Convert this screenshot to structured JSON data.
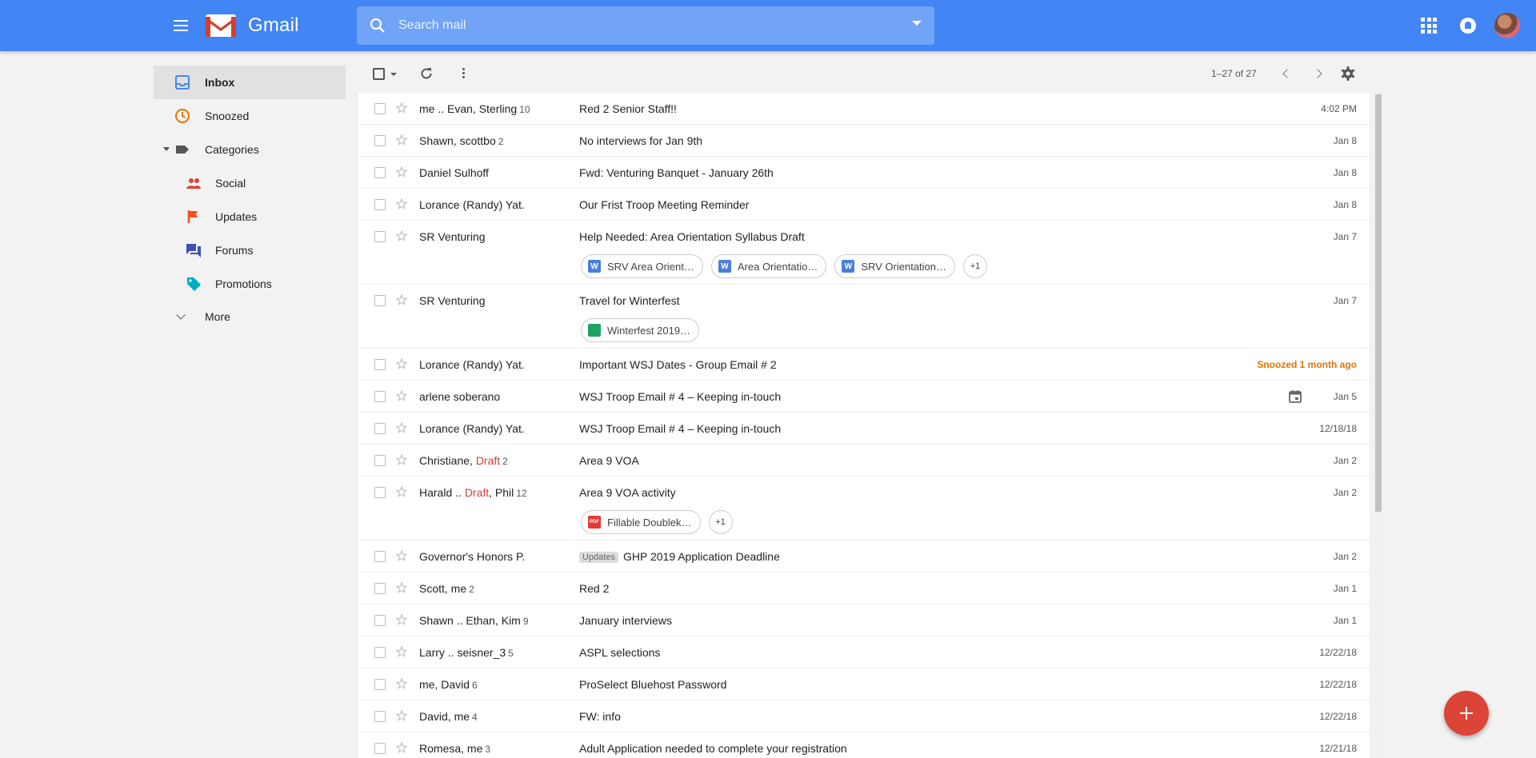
{
  "app": {
    "brand": "Gmail"
  },
  "search": {
    "placeholder": "Search mail",
    "value": ""
  },
  "sidebar": {
    "items": [
      {
        "label": "Inbox",
        "icon": "inbox-icon",
        "color": "#4285f4",
        "active": true
      },
      {
        "label": "Snoozed",
        "icon": "clock-icon",
        "color": "#e37400"
      },
      {
        "label": "Categories",
        "icon": "label-icon",
        "color": "#555555"
      },
      {
        "label": "Social",
        "icon": "people-icon",
        "color": "#db4437"
      },
      {
        "label": "Updates",
        "icon": "flag-icon",
        "color": "#f4511e"
      },
      {
        "label": "Forums",
        "icon": "forum-icon",
        "color": "#3f51b5"
      },
      {
        "label": "Promotions",
        "icon": "tag-icon",
        "color": "#00acc1"
      },
      {
        "label": "More",
        "icon": "chevron-down-icon"
      }
    ]
  },
  "toolbar": {
    "page_count": "1–27 of 27"
  },
  "emails": [
    {
      "sender": "me .. Evan, Sterling",
      "count": "10",
      "subject": "Red 2 Senior Staff!!",
      "date": "4:02 PM"
    },
    {
      "sender": "Shawn, scottbo",
      "count": "2",
      "subject": "No interviews for Jan 9th",
      "date": "Jan 8"
    },
    {
      "sender": "Daniel Sulhoff",
      "subject": "Fwd: Venturing Banquet - January 26th",
      "date": "Jan 8"
    },
    {
      "sender": "Lorance (Randy) Yat.",
      "subject": "Our Frist Troop Meeting Reminder",
      "date": "Jan 8"
    },
    {
      "sender": "SR Venturing",
      "subject": "Help Needed: Area Orientation Syllabus Draft",
      "date": "Jan 7",
      "attachments": [
        {
          "type": "word",
          "glyph": "W",
          "label": "SRV Area Orient…"
        },
        {
          "type": "word",
          "glyph": "W",
          "label": "Area Orientatio…"
        },
        {
          "type": "word",
          "glyph": "W",
          "label": "SRV Orientation…"
        }
      ],
      "more": "+1"
    },
    {
      "sender": "SR Venturing",
      "subject": "Travel for Winterfest",
      "date": "Jan 7",
      "attachments": [
        {
          "type": "sheet",
          "glyph": "",
          "label": "Winterfest 2019…"
        }
      ]
    },
    {
      "sender": "Lorance (Randy) Yat.",
      "subject": "Important WSJ Dates - Group Email # 2",
      "date": "Snoozed 1 month ago",
      "snoozed": true
    },
    {
      "sender": "arlene soberano",
      "subject": "WSJ Troop Email # 4 – Keeping in-touch",
      "date": "Jan 5",
      "calendar": true
    },
    {
      "sender": "Lorance (Randy) Yat.",
      "subject": "WSJ Troop Email # 4 – Keeping in-touch",
      "date": "12/18/18"
    },
    {
      "sender": "Christiane, ",
      "draft": "Draft",
      "count": "2",
      "subject": "Area 9 VOA",
      "date": "Jan 2"
    },
    {
      "sender": "Harald .. ",
      "draft": "Draft",
      "sender_after": ", Phil",
      "count": "12",
      "subject": "Area 9 VOA activity",
      "date": "Jan 2",
      "attachments": [
        {
          "type": "pdf",
          "glyph": "PDF",
          "label": "Fillable Doublek…"
        }
      ],
      "more": "+1"
    },
    {
      "sender": "Governor's Honors P.",
      "label": "Updates",
      "subject": "GHP 2019 Application Deadline",
      "date": "Jan 2"
    },
    {
      "sender": "Scott, me",
      "count": "2",
      "subject": "Red 2",
      "date": "Jan 1"
    },
    {
      "sender": "Shawn .. Ethan, Kim",
      "count": "9",
      "subject": "January interviews",
      "date": "Jan 1"
    },
    {
      "sender": "Larry .. seisner_3",
      "count": "5",
      "subject": "ASPL selections",
      "date": "12/22/18"
    },
    {
      "sender": "me, David",
      "count": "6",
      "subject": "ProSelect Bluehost Password",
      "date": "12/22/18"
    },
    {
      "sender": "David, me",
      "count": "4",
      "subject": "FW: info",
      "date": "12/22/18"
    },
    {
      "sender": "Romesa, me",
      "count": "3",
      "subject": "Adult Application needed to complete your registration",
      "date": "12/21/18"
    }
  ],
  "colors": {
    "header": "#4285f4",
    "fab": "#db4437",
    "snoozed": "#e37400",
    "draft": "#d23f31"
  }
}
